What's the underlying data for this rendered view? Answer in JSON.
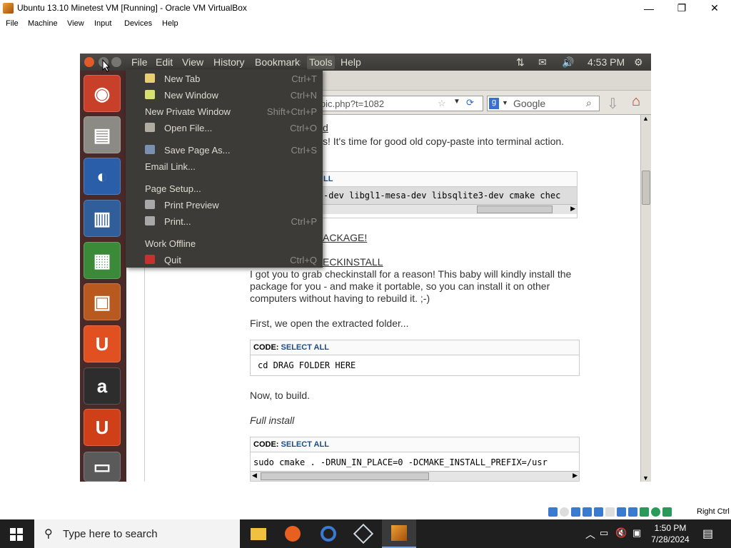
{
  "host": {
    "title": "Ubuntu 13.10 Minetest VM [Running] - Oracle VM VirtualBox",
    "menu": [
      "File",
      "Machine",
      "View",
      "Input",
      "Devices",
      "Help"
    ],
    "status_right": "Right Ctrl"
  },
  "guest_panel": {
    "menus": [
      "File",
      "Edit",
      "View",
      "History",
      "Bookmarks",
      "Tools",
      "Help"
    ],
    "time": "4:53 PM"
  },
  "firefox": {
    "url_partial": "topic.php?t=1082",
    "search_placeholder": "Google"
  },
  "tools_menu": [
    {
      "label": "New Tab",
      "shortcut": "Ctrl+T",
      "icon": "new-tab-icon"
    },
    {
      "label": "New Window",
      "shortcut": "Ctrl+N",
      "icon": "new-window-icon"
    },
    {
      "label": "New Private Window",
      "shortcut": "Shift+Ctrl+P",
      "icon": ""
    },
    {
      "label": "Open File...",
      "shortcut": "Ctrl+O",
      "icon": "folder-icon"
    },
    {
      "label": "Save Page As...",
      "shortcut": "Ctrl+S",
      "icon": "save-icon"
    },
    {
      "label": "Email Link...",
      "shortcut": "",
      "icon": ""
    },
    {
      "label": "Page Setup...",
      "shortcut": "",
      "icon": ""
    },
    {
      "label": "Print Preview",
      "shortcut": "",
      "icon": "print-preview-icon"
    },
    {
      "label": "Print...",
      "shortcut": "Ctrl+P",
      "icon": "printer-icon"
    },
    {
      "label": "Work Offline",
      "shortcut": "",
      "icon": ""
    },
    {
      "label": "Quit",
      "shortcut": "Ctrl+Q",
      "icon": "quit-icon"
    }
  ],
  "page": {
    "partial_heading": "d",
    "intro": "s! It's time for good old copy-paste into terminal action.",
    "code1_head_partial": "LL",
    "code1": "-dev libgl1-mesa-dev libsqlite3-dev cmake chec",
    "pkg_heading_partial": "ACKAGE!",
    "checkinstall_heading_partial": "ECKINSTALL",
    "para1": "I got you to grab checkinstall for a reason! This baby will kindly install the package for you - and make it portable, so you can install it on other computers without having to rebuild it. ;-)",
    "para2": "First, we open the extracted folder...",
    "code_label": "CODE:",
    "select_all": "SELECT ALL",
    "code2": "cd DRAG FOLDER HERE",
    "para3": "Now, to build.",
    "para4": "Full install",
    "code3": "sudo cmake . -DRUN_IN_PLACE=0 -DCMAKE_INSTALL_PREFIX=/usr"
  },
  "taskbar": {
    "search_placeholder": "Type here to search",
    "time": "1:50 PM",
    "date": "7/28/2024"
  }
}
